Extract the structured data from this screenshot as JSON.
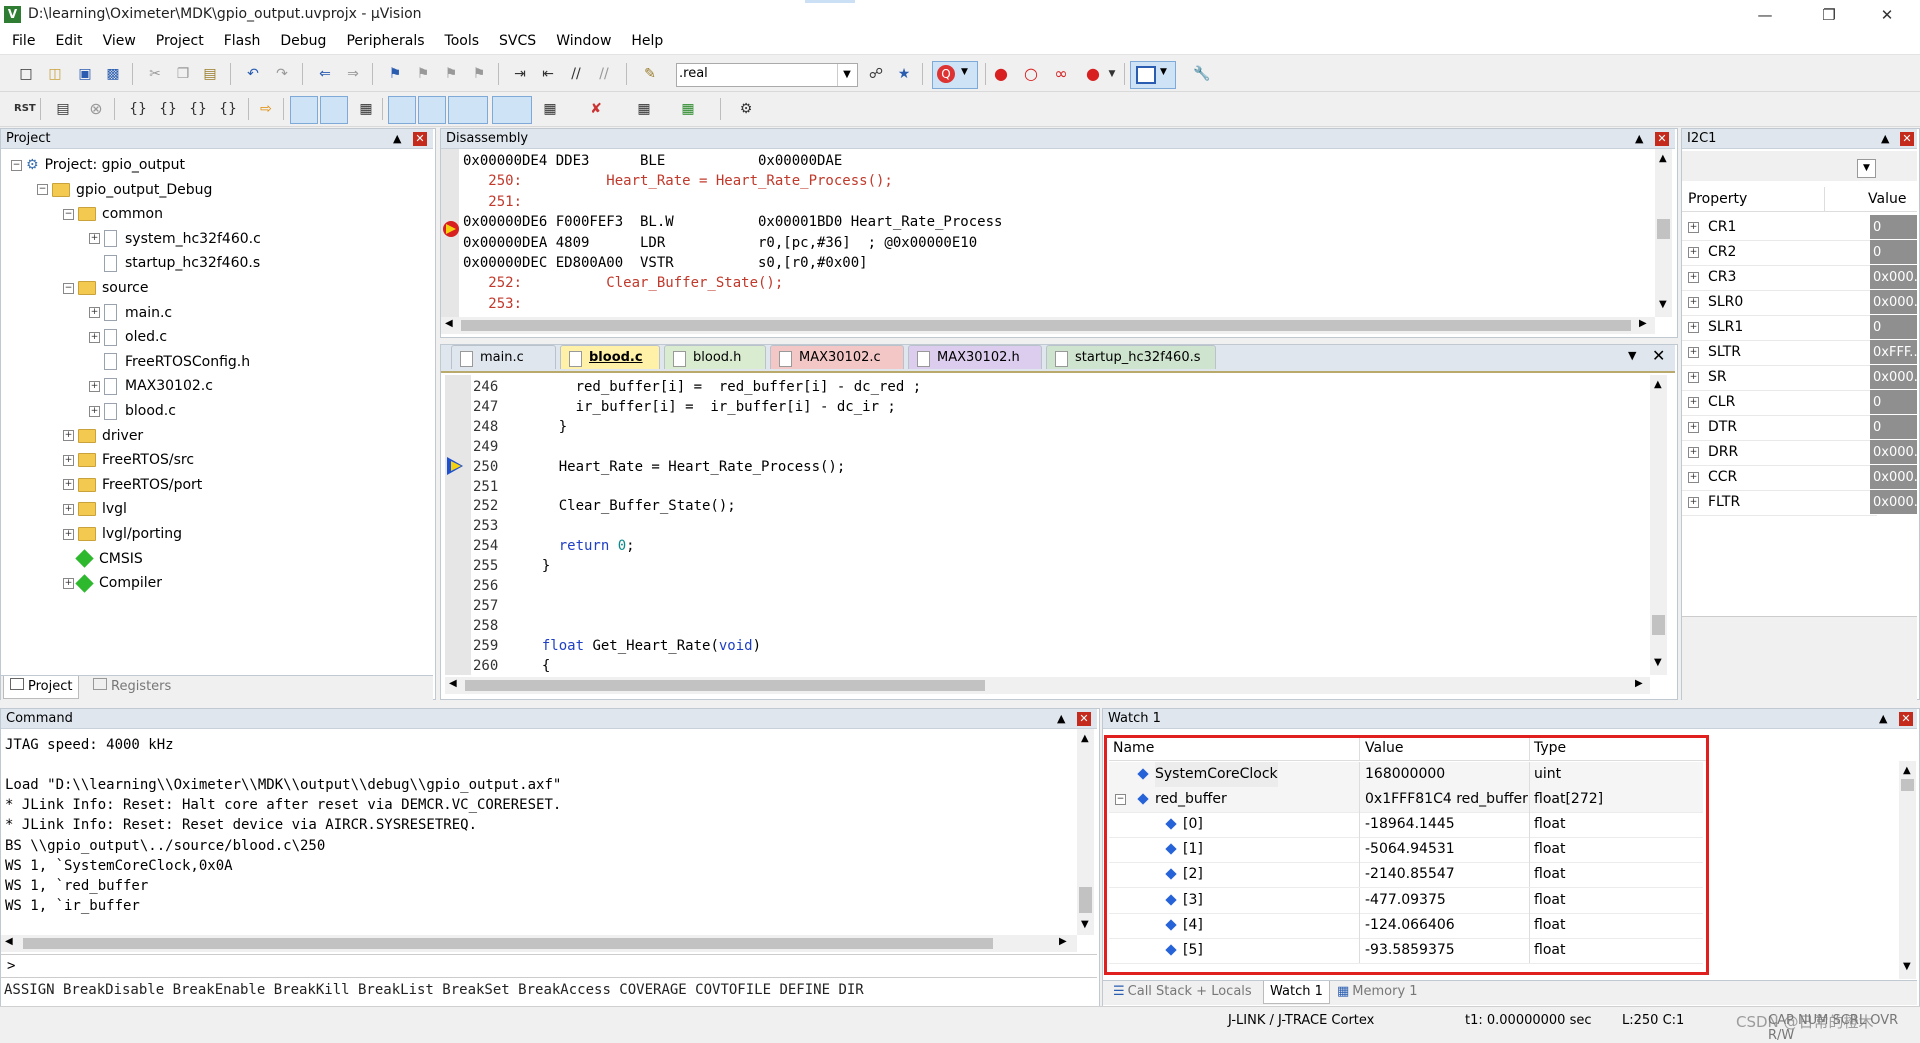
{
  "window": {
    "title": "D:\\learning\\Oximeter\\MDK\\gpio_output.uvprojx - µVision",
    "app_icon": "uv-icon",
    "min": "—",
    "max": "❐",
    "close": "✕"
  },
  "menu": [
    "File",
    "Edit",
    "View",
    "Project",
    "Flash",
    "Debug",
    "Peripherals",
    "Tools",
    "SVCS",
    "Window",
    "Help"
  ],
  "toolbar": {
    "target_name": ".real",
    "rst_label": "RST"
  },
  "project_panel": {
    "title": "Project",
    "tree": [
      {
        "label": "Project: gpio_output",
        "level": 0,
        "kind": "root",
        "exp": "−"
      },
      {
        "label": "gpio_output_Debug",
        "level": 1,
        "kind": "folder",
        "exp": "−"
      },
      {
        "label": "common",
        "level": 2,
        "kind": "folder",
        "exp": "−"
      },
      {
        "label": "system_hc32f460.c",
        "level": 3,
        "kind": "file",
        "exp": "+"
      },
      {
        "label": "startup_hc32f460.s",
        "level": 3,
        "kind": "file",
        "exp": ""
      },
      {
        "label": "source",
        "level": 2,
        "kind": "folder",
        "exp": "−"
      },
      {
        "label": "main.c",
        "level": 3,
        "kind": "file",
        "exp": "+"
      },
      {
        "label": "oled.c",
        "level": 3,
        "kind": "file",
        "exp": "+"
      },
      {
        "label": "FreeRTOSConfig.h",
        "level": 3,
        "kind": "file",
        "exp": ""
      },
      {
        "label": "MAX30102.c",
        "level": 3,
        "kind": "file",
        "exp": "+"
      },
      {
        "label": "blood.c",
        "level": 3,
        "kind": "file",
        "exp": "+"
      },
      {
        "label": "driver",
        "level": 2,
        "kind": "folder",
        "exp": "+"
      },
      {
        "label": "FreeRTOS/src",
        "level": 2,
        "kind": "folder",
        "exp": "+"
      },
      {
        "label": "FreeRTOS/port",
        "level": 2,
        "kind": "folder",
        "exp": "+"
      },
      {
        "label": "lvgl",
        "level": 2,
        "kind": "folder",
        "exp": "+"
      },
      {
        "label": "lvgl/porting",
        "level": 2,
        "kind": "folder",
        "exp": "+"
      },
      {
        "label": "CMSIS",
        "level": 2,
        "kind": "gem",
        "exp": ""
      },
      {
        "label": "Compiler",
        "level": 2,
        "kind": "gem",
        "exp": "+"
      }
    ],
    "tabs": [
      "Project",
      "Registers"
    ]
  },
  "disassembly": {
    "title": "Disassembly",
    "lines": [
      {
        "text": "0x00000DE4 DDE3      BLE           0x00000DAE",
        "type": "asm"
      },
      {
        "text": "   250:          Heart_Rate = Heart_Rate_Process();",
        "type": "src"
      },
      {
        "text": "   251:",
        "type": "src"
      },
      {
        "text": "0x00000DE6 F000FEF3  BL.W          0x00001BD0 Heart_Rate_Process",
        "type": "asm"
      },
      {
        "text": "0x00000DEA 4809      LDR           r0,[pc,#36]  ; @0x00000E10",
        "type": "asm"
      },
      {
        "text": "0x00000DEC ED800A00  VSTR          s0,[r0,#0x00]",
        "type": "asm"
      },
      {
        "text": "   252:          Clear_Buffer_State();",
        "type": "src"
      },
      {
        "text": "   253:",
        "type": "src"
      }
    ]
  },
  "editor": {
    "tabs": [
      {
        "label": "main.c",
        "color": "#dfe6ee"
      },
      {
        "label": "blood.c",
        "color": "#fff2a8"
      },
      {
        "label": "blood.h",
        "color": "#d9eccf"
      },
      {
        "label": "MAX30102.c",
        "color": "#f4c7c7"
      },
      {
        "label": "MAX30102.h",
        "color": "#dccdee"
      },
      {
        "label": "startup_hc32f460.s",
        "color": "#cfe4cf"
      }
    ],
    "lines": [
      {
        "num": "246",
        "code": "      red_buffer[i] =  red_buffer[i] - dc_red ;"
      },
      {
        "num": "247",
        "code": "      ir_buffer[i] =  ir_buffer[i] - dc_ir ;"
      },
      {
        "num": "248",
        "code": "    }"
      },
      {
        "num": "249",
        "code": ""
      },
      {
        "num": "250",
        "code": "    Heart_Rate = Heart_Rate_Process();"
      },
      {
        "num": "251",
        "code": ""
      },
      {
        "num": "252",
        "code": "    Clear_Buffer_State();"
      },
      {
        "num": "253",
        "code": ""
      },
      {
        "num": "254",
        "code": "    return 0;"
      },
      {
        "num": "255",
        "code": "  }"
      },
      {
        "num": "256",
        "code": ""
      },
      {
        "num": "257",
        "code": ""
      },
      {
        "num": "258",
        "code": ""
      },
      {
        "num": "259",
        "code": "  float Get_Heart_Rate(void)"
      },
      {
        "num": "260",
        "code": "  {"
      }
    ]
  },
  "i2c_panel": {
    "title": "I2C1",
    "headers": [
      "Property",
      "Value"
    ],
    "rows": [
      {
        "name": "CR1",
        "value": "0"
      },
      {
        "name": "CR2",
        "value": "0"
      },
      {
        "name": "CR3",
        "value": "0x000..."
      },
      {
        "name": "SLR0",
        "value": "0x000..."
      },
      {
        "name": "SLR1",
        "value": "0"
      },
      {
        "name": "SLTR",
        "value": "0xFFF..."
      },
      {
        "name": "SR",
        "value": "0x000..."
      },
      {
        "name": "CLR",
        "value": "0"
      },
      {
        "name": "DTR",
        "value": "0"
      },
      {
        "name": "DRR",
        "value": "0x000..."
      },
      {
        "name": "CCR",
        "value": "0x000..."
      },
      {
        "name": "FLTR",
        "value": "0x000..."
      }
    ]
  },
  "command": {
    "title": "Command",
    "lines": [
      "JTAG speed: 4000 kHz",
      "",
      "Load \"D:\\\\learning\\\\Oximeter\\\\MDK\\\\output\\\\debug\\\\gpio_output.axf\"",
      "* JLink Info: Reset: Halt core after reset via DEMCR.VC_CORERESET.",
      "* JLink Info: Reset: Reset device via AIRCR.SYSRESETREQ.",
      "BS \\\\gpio_output\\../source/blood.c\\250",
      "WS 1, `SystemCoreClock,0x0A",
      "WS 1, `red_buffer",
      "WS 1, `ir_buffer"
    ],
    "prompt": ">",
    "help_line": "ASSIGN BreakDisable BreakEnable BreakKill BreakList BreakSet BreakAccess COVERAGE COVTOFILE DEFINE DIR"
  },
  "watch": {
    "title": "Watch 1",
    "headers": [
      "Name",
      "Value",
      "Type"
    ],
    "rows": [
      {
        "name": "SystemCoreClock",
        "value": "168000000",
        "type": "uint",
        "indent": 0,
        "exp": ""
      },
      {
        "name": "red_buffer",
        "value": "0x1FFF81C4 red_buffer",
        "type": "float[272]",
        "indent": 0,
        "exp": "−"
      },
      {
        "name": "[0]",
        "value": "-18964.1445",
        "type": "float",
        "indent": 1,
        "exp": ""
      },
      {
        "name": "[1]",
        "value": "-5064.94531",
        "type": "float",
        "indent": 1,
        "exp": ""
      },
      {
        "name": "[2]",
        "value": "-2140.85547",
        "type": "float",
        "indent": 1,
        "exp": ""
      },
      {
        "name": "[3]",
        "value": "-477.09375",
        "type": "float",
        "indent": 1,
        "exp": ""
      },
      {
        "name": "[4]",
        "value": "-124.066406",
        "type": "float",
        "indent": 1,
        "exp": ""
      },
      {
        "name": "[5]",
        "value": "-93.5859375",
        "type": "float",
        "indent": 1,
        "exp": ""
      }
    ],
    "tabs": [
      "Call Stack + Locals",
      "Watch 1",
      "Memory 1"
    ]
  },
  "statusbar": {
    "debugger": "J-LINK / J-TRACE Cortex",
    "time": "t1: 0.00000000 sec",
    "pos": "L:250 C:1",
    "caps": "CAP  NUM  SCRL  OVR  R/W",
    "watermark": "CSDN @日常的橙木"
  },
  "colors": {
    "highlight_box": "#e0201e",
    "panel_header": "#dfe6ee",
    "keyword": "#1f3fc4",
    "source_line": "#c0392b"
  }
}
